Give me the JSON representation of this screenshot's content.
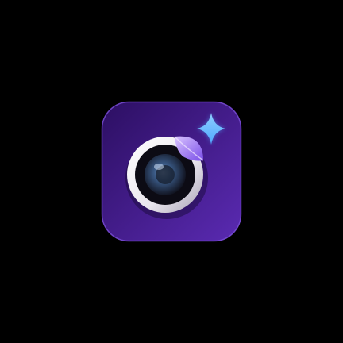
{
  "icon": {
    "name": "camera-sticker-app-icon",
    "glyphs": [
      "camera-lens-icon",
      "page-curl-icon",
      "sparkle-icon"
    ]
  },
  "colors": {
    "background": "#000000",
    "tile_dark": "#2c0f62",
    "tile_light": "#5a2ab2",
    "tile_border": "#7a4fd6",
    "lens_ring": "#e9e6ee",
    "lens_ring_shadow": "#a8a2b4",
    "lens_dark": "#0c0b14",
    "lens_glass": "#3a5a86",
    "curl_light": "#d9c4ff",
    "curl_dark": "#7a4ee8",
    "sparkle": "#4fa8ff"
  }
}
